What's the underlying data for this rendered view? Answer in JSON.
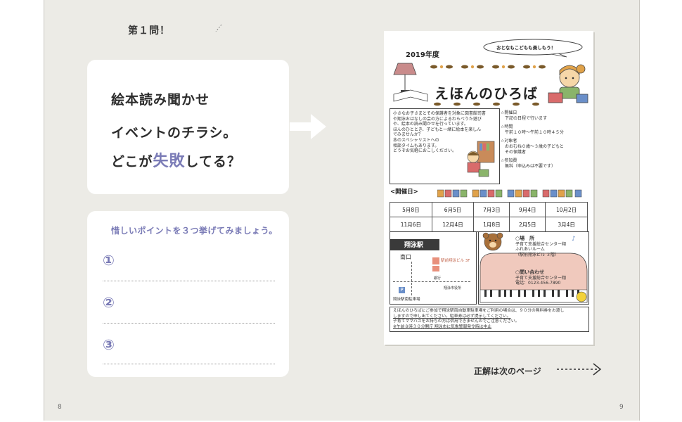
{
  "left": {
    "question_label": "第１問！",
    "question_lines": [
      "絵本読み聞かせ",
      "イベントのチラシ。"
    ],
    "question_line3_pre": "どこが",
    "question_accent": "失敗",
    "question_line3_post": "してる？",
    "answer_prompt": "惜しいポイントを３つ挙げてみましょう。",
    "answer_numbers": [
      "①",
      "②",
      "③"
    ]
  },
  "flyer": {
    "year": "2019年度",
    "bubble": "おとなもこどもも楽しもう！",
    "title": "えほんのひろば",
    "intro": [
      "小さなお子さまとその保護者を対象に図書館司書",
      "や翔泳おはなしの会の方によるわらべうた遊び",
      "や、絵本の読み聞かせを行っています。",
      "ほんのひととき、子どもと一緒に絵本を楽しん",
      "でみませんか？",
      "本のスペシャリストへの",
      "相談タイムもあります。",
      "どうぞお気軽におこしください。"
    ],
    "info": [
      "☆開催日",
      "　下記の日程で行います",
      "☆時間",
      "　午前１０時〜午前１０時４５分",
      "☆対象者",
      "　おおむね０歳〜３歳の子どもと",
      "　その保護者",
      "☆参加費",
      "　無料（申込みは不要です）"
    ],
    "dates_label": "<開催日>",
    "dates": [
      [
        "5月8日",
        "6月5日",
        "7月3日",
        "9月4日",
        "10月2日"
      ],
      [
        "11月6日",
        "12月4日",
        "1月8日",
        "2月5日",
        "3月4日"
      ]
    ],
    "map_station": "翔泳駅",
    "map_exit": "南口",
    "map_building": "駅前翔泳ビル 3F",
    "map_parking": "翔泳駅南駐車場",
    "map_office": "翔泳市役所",
    "map_bank": "銀行",
    "venue": [
      "○場　所",
      "子育て支援総合センター翔",
      "ふれあいルーム",
      "（駅前翔泳ビル ３階）"
    ],
    "contact": [
      "○問い合わせ",
      "子育て支援総合センター翔",
      "電話：0123-456-7890"
    ],
    "notice": [
      "えほんのひろばにご参加で翔泳駅南自動車駐車場をご利用の場合は、９０分の無料券をお渡し",
      "しますので申し出てください。駐車券は必ず提示してください。",
      "子育てママバスをお持ちの方は併用できませんのでご注意ください。",
      "※午前８時３０分開庁 翔泳市に気象警報発令時は中止"
    ]
  },
  "next_page": "正解は次のページ",
  "page_left": "8",
  "page_right": "9",
  "colors": {
    "accent": "#7a7bb6",
    "background": "#ecebe6",
    "salmon": "#e8907c",
    "piano": "#f0c9bd"
  }
}
